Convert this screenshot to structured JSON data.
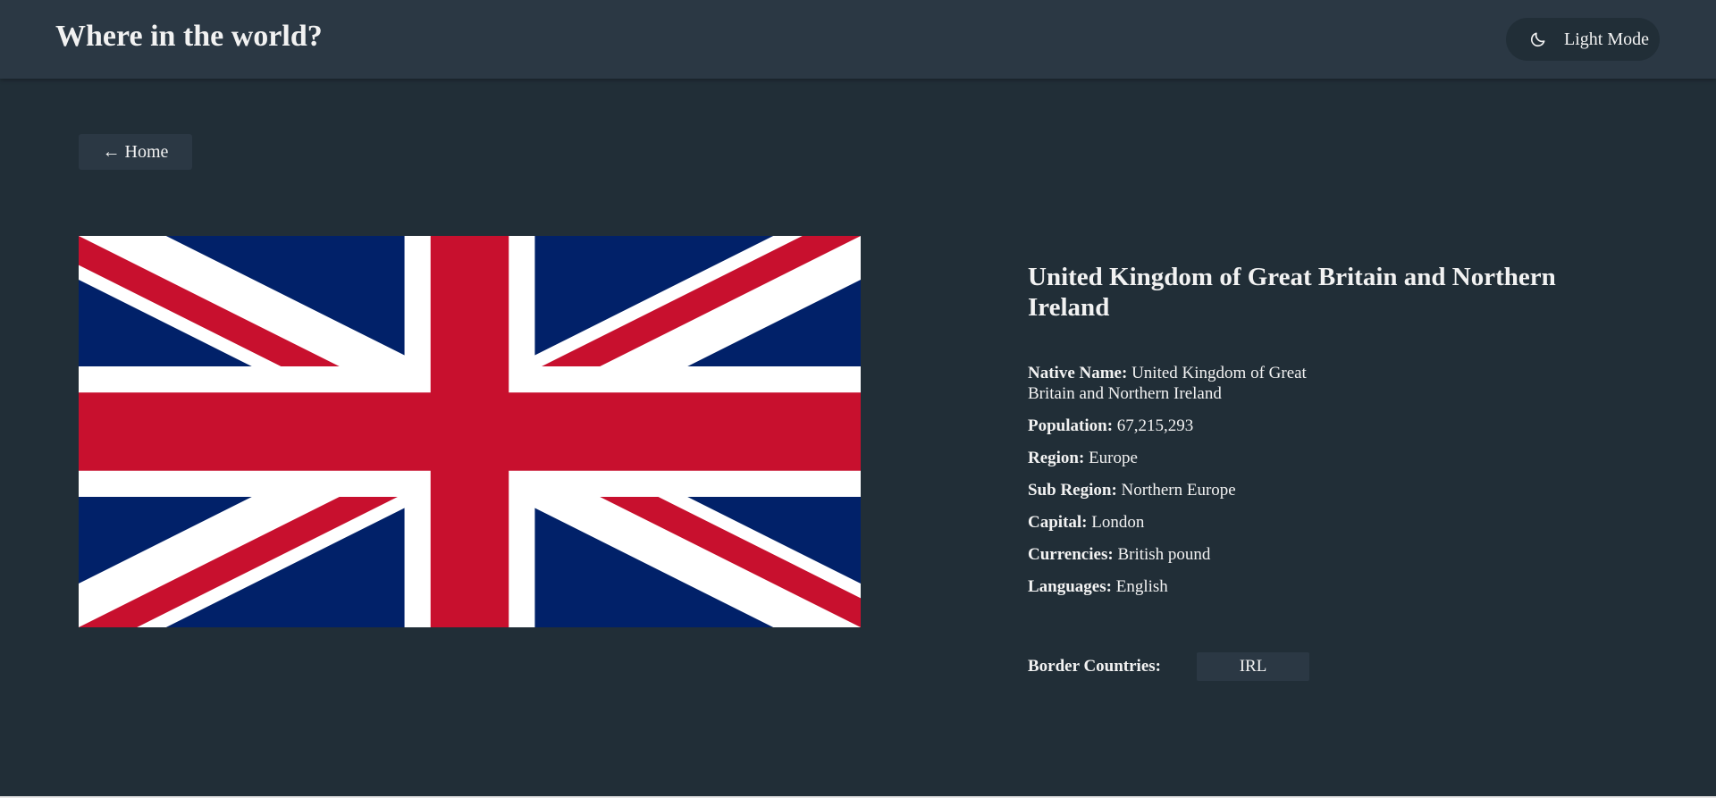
{
  "header": {
    "title": "Where in the world?",
    "theme_toggle_label": "Light Mode",
    "theme_icon": "moon-icon"
  },
  "nav": {
    "home_label": "← Home"
  },
  "country": {
    "name": "United Kingdom of Great Britain and Northern Ireland",
    "flag_icon": "union-jack-flag",
    "details": [
      {
        "label": "Native Name:",
        "value": "United Kingdom of Great Britain and Northern Ireland"
      },
      {
        "label": "Population:",
        "value": "67,215,293"
      },
      {
        "label": "Region:",
        "value": "Europe"
      },
      {
        "label": "Sub Region:",
        "value": "Northern Europe"
      },
      {
        "label": "Capital:",
        "value": "London"
      },
      {
        "label": "Currencies:",
        "value": "British pound"
      },
      {
        "label": "Languages:",
        "value": "English"
      }
    ],
    "border_label": "Border Countries:",
    "border_countries": [
      "IRL"
    ]
  },
  "colors": {
    "background": "#212e37",
    "surface": "#2b3844",
    "text": "#f2f2f2",
    "flag_blue": "#012169",
    "flag_red": "#c8102e",
    "flag_white": "#ffffff"
  }
}
